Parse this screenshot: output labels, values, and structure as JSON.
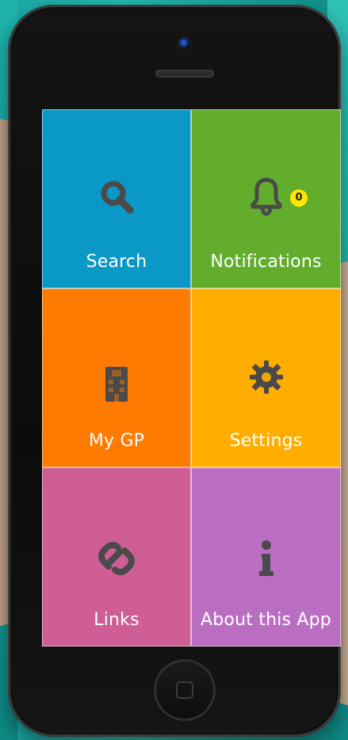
{
  "app": {
    "title": ""
  },
  "tiles": [
    {
      "id": "search",
      "label": "Search",
      "icon": "search-icon",
      "color": "#0a98c7"
    },
    {
      "id": "notifications",
      "label": "Notifications",
      "icon": "bell-icon",
      "color": "#62ad2c",
      "badge": "0",
      "badge_color": "#ffe600"
    },
    {
      "id": "my-gp",
      "label": "My GP",
      "icon": "hospital-building-icon",
      "color": "#ff7a00"
    },
    {
      "id": "settings",
      "label": "Settings",
      "icon": "gear-icon",
      "color": "#ffae00"
    },
    {
      "id": "links",
      "label": "Links",
      "icon": "link-icon",
      "color": "#cf5d96"
    },
    {
      "id": "about",
      "label": "About this App",
      "icon": "info-icon",
      "color": "#ba6ec2"
    }
  ],
  "device": {
    "home_button_icon": "home-square-icon"
  }
}
